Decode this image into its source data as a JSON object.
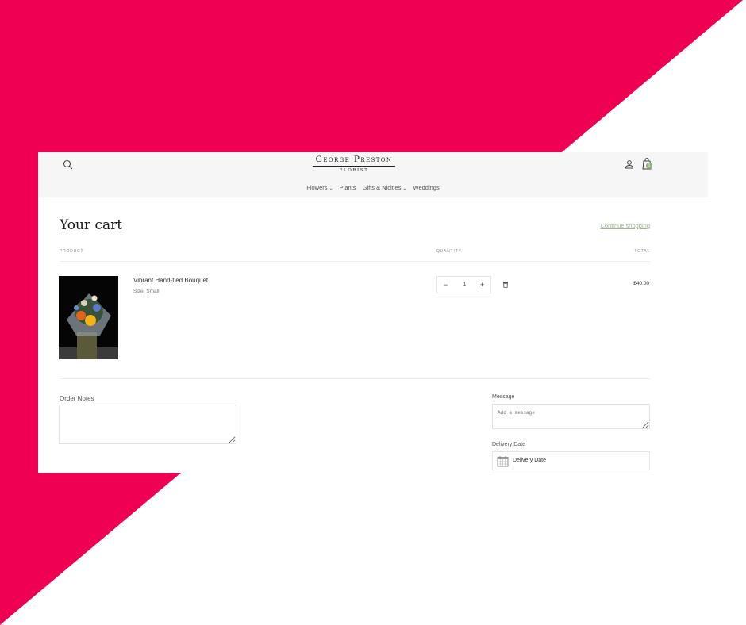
{
  "colors": {
    "backdrop_accent": "#ee0052",
    "brand_green": "#8fae7e",
    "link_green": "#9cb98a"
  },
  "header": {
    "logo": {
      "name": "George Preston",
      "subtitle": "FLORIST"
    },
    "icons": {
      "search": "search-icon",
      "account": "account-icon",
      "cart": "cart-icon"
    },
    "cart_count": "1",
    "nav": [
      {
        "label": "Flowers",
        "has_dropdown": true
      },
      {
        "label": "Plants",
        "has_dropdown": false
      },
      {
        "label": "Gifts & Nicities",
        "has_dropdown": true
      },
      {
        "label": "Weddings",
        "has_dropdown": false
      }
    ]
  },
  "cart": {
    "title": "Your cart",
    "continue_label": "Continue shopping",
    "columns": {
      "product": "PRODUCT",
      "quantity": "QUANTITY",
      "total": "TOTAL"
    },
    "items": [
      {
        "name": "Vibrant Hand-tied Bouquet",
        "variant": "Size: Small",
        "quantity": "1",
        "price": "£40.00",
        "minus": "−",
        "plus": "+"
      }
    ]
  },
  "form": {
    "order_notes_label": "Order Notes",
    "message_label": "Message",
    "message_placeholder": "Add a message",
    "delivery_label": "Delivery Date",
    "delivery_placeholder": "Delivery Date"
  }
}
